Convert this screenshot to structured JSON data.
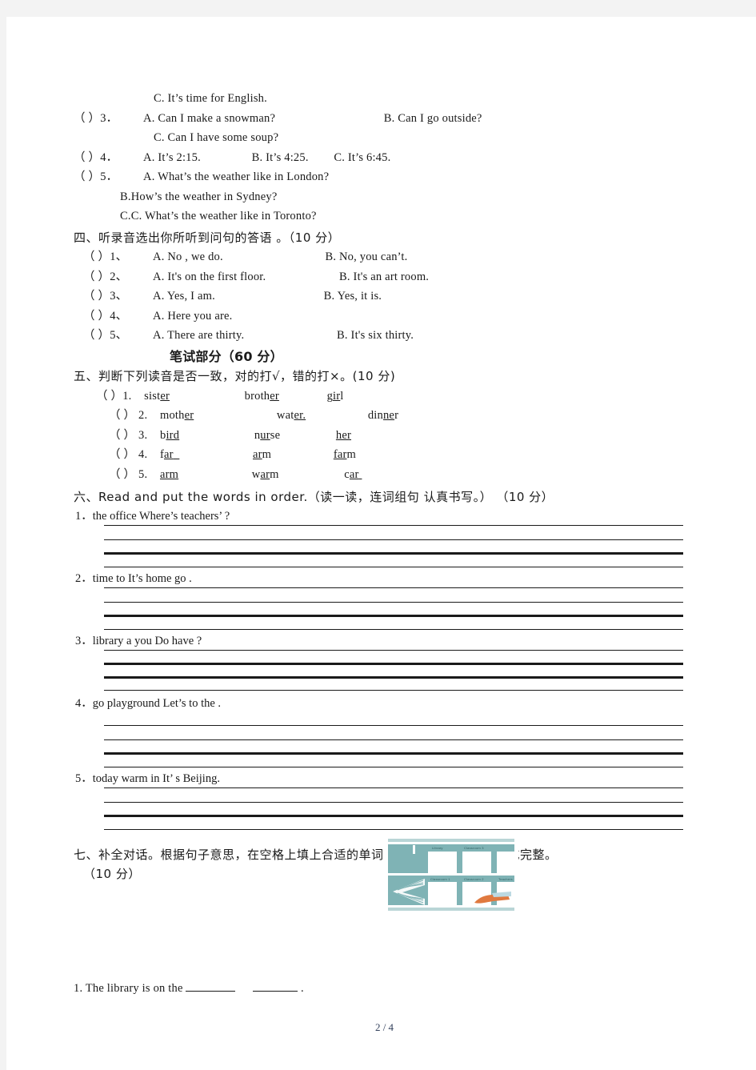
{
  "page": {
    "footer": "2 / 4"
  },
  "listening_part": {
    "q2_option_c": "C. It’s  time  for  English.",
    "items": [
      {
        "bracket": "（   ）3．",
        "a": "A.  Can  I  make  a  snowman?",
        "b": "B.  Can  I  go  outside?",
        "c": "C.  Can  I  have  some  soup?"
      },
      {
        "bracket": "（   ）4．",
        "a": "A.  It’s  2:15.",
        "b": "B.  It’s  4:25.",
        "c": "C.  It’s  6:45."
      },
      {
        "bracket": "（   ）5．",
        "a": "A.  What’s  the  weather  like  in  London?",
        "b": "B.How’s  the  weather  in  Sydney?",
        "c": "C.C.  What’s  the  weather  like  in  Toronto?"
      }
    ]
  },
  "section_four": {
    "heading": "四、听录音选出你所听到问句的答语 。（10 分）",
    "rows": [
      {
        "bracket": "（   ）1、",
        "a": "A. No , we do.",
        "b": "B. No, you can’t."
      },
      {
        "bracket": "（   ）2、",
        "a": "A. It's  on  the  first  floor.",
        "b": "B. It's  an  art  room."
      },
      {
        "bracket": "（   ）3、",
        "a": "A. Yes,  I am.",
        "b": "B. Yes,  it  is."
      },
      {
        "bracket": "（   ）4、",
        "a": "A. Here  you  are.",
        "b": ""
      },
      {
        "bracket": "（   ）5、",
        "a": "A. There  are  thirty.",
        "b": "B. It's  six  thirty."
      }
    ]
  },
  "written_part": {
    "title": "笔试部分（60 分）"
  },
  "section_five": {
    "heading": "五、判断下列读音是否一致，对的打√，错的打×。(10 分)",
    "rows": [
      {
        "bracket": "（   ）1.",
        "w1_pre": "sist",
        "w1_ul": "er",
        "w1_post": "",
        "w2_pre": "broth",
        "w2_ul": "er",
        "w2_post": "",
        "w3_pre": "g",
        "w3_ul": "ir",
        "w3_post": "l"
      },
      {
        "bracket": "（   ） 2.",
        "w1_pre": "moth",
        "w1_ul": "er",
        "w1_post": "",
        "w2_pre": "wat",
        "w2_ul": "er.",
        "w2_post": "",
        "w3_pre": "din",
        "w3_ul": "ne",
        "w3_post": "r"
      },
      {
        "bracket": "（   ） 3.",
        "w1_pre": "b",
        "w1_ul": "ird",
        "w1_post": "",
        "w2_pre": "n",
        "w2_ul": "ur",
        "w2_post": "se",
        "w3_pre": "",
        "w3_ul": "her",
        "w3_post": ""
      },
      {
        "bracket": "（   ） 4.",
        "w1_pre": "f",
        "w1_ul": "ar",
        "w1_post": "",
        "w2_pre": "",
        "w2_ul": "ar",
        "w2_post": "m",
        "w3_pre": "",
        "w3_ul": "far",
        "w3_post": "m"
      },
      {
        "bracket": "（   ） 5.",
        "w1_pre": "",
        "w1_ul": "arm",
        "w1_post": "",
        "w2_pre": "w",
        "w2_ul": "ar",
        "w2_post": "m",
        "w3_pre": "c",
        "w3_ul": "ar",
        "w3_post": ""
      }
    ]
  },
  "section_six": {
    "heading": "六、Read  and  put  the  words  in  order.（读一读，连词组句 认真书写。） （10 分）",
    "questions": [
      "1．the   office   Where’s   teachers’ ?",
      "2．time   to   It’s   home   go .",
      "3．library   a   you   Do   have   ?",
      "4．go   playground   Let’s   to   the .",
      "5．today   warm   in   It’ s   Beijing."
    ]
  },
  "section_seven": {
    "heading_line1": "七、补全对话。根据句子意思，在空格上填上合适的单词，每空一词，将对话补充完整。",
    "heading_line2": "（10 分）",
    "question_1_pre": "1. The  library  is  on  the ",
    "question_1_post": "."
  },
  "floorplan": {
    "labels": [
      "Library",
      "Classroom 3",
      "Classroom 1",
      "Classroom 2",
      "Teachers"
    ],
    "wall_color": "#7fb3b5",
    "room_color": "#ffffff"
  }
}
